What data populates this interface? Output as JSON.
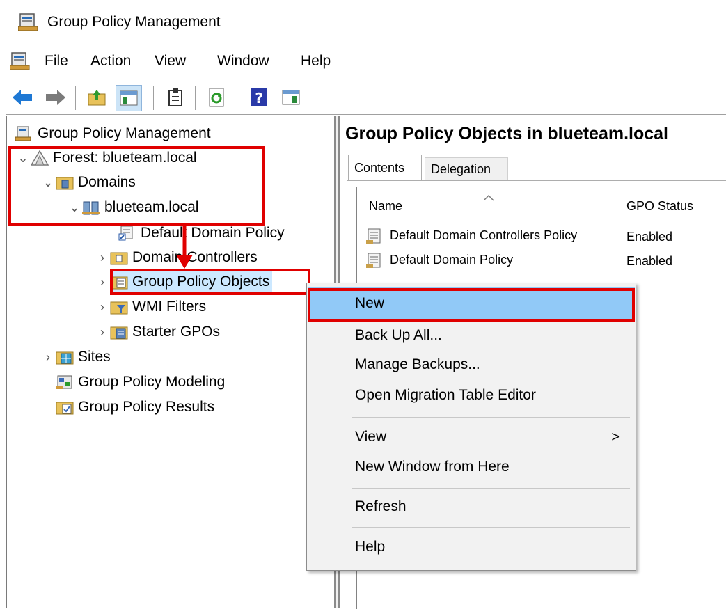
{
  "window": {
    "title": "Group Policy Management"
  },
  "menu": [
    "File",
    "Action",
    "View",
    "Window",
    "Help"
  ],
  "toolbar": [
    "back-icon",
    "forward-icon",
    "up-folder-icon",
    "show-hide-tree-icon",
    "properties-icon",
    "refresh-icon",
    "help-icon",
    "action-pane-icon"
  ],
  "tree": {
    "root": "Group Policy Management",
    "forest": "Forest: blueteam.local",
    "domains": "Domains",
    "domain": "blueteam.local",
    "default_domain_policy": "Default Domain Policy",
    "domain_controllers": "Domain Controllers",
    "group_policy_objects": "Group Policy Objects",
    "wmi_filters": "WMI Filters",
    "starter_gpos": "Starter GPOs",
    "sites": "Sites",
    "modeling": "Group Policy Modeling",
    "results": "Group Policy Results"
  },
  "right": {
    "heading": "Group Policy Objects in blueteam.local",
    "tabs": [
      "Contents",
      "Delegation"
    ],
    "columns": [
      "Name",
      "GPO Status"
    ],
    "rows": [
      {
        "name": "Default Domain Controllers Policy",
        "status": "Enabled"
      },
      {
        "name": "Default Domain Policy",
        "status": "Enabled"
      }
    ]
  },
  "context_menu": {
    "items": [
      "New",
      "Back Up All...",
      "Manage Backups...",
      "Open Migration Table Editor",
      "View",
      "New Window from Here",
      "Refresh",
      "Help"
    ],
    "submenu_arrow": ">"
  },
  "colors": {
    "highlight": "#91c9f7",
    "annotation_red": "#e00000"
  }
}
